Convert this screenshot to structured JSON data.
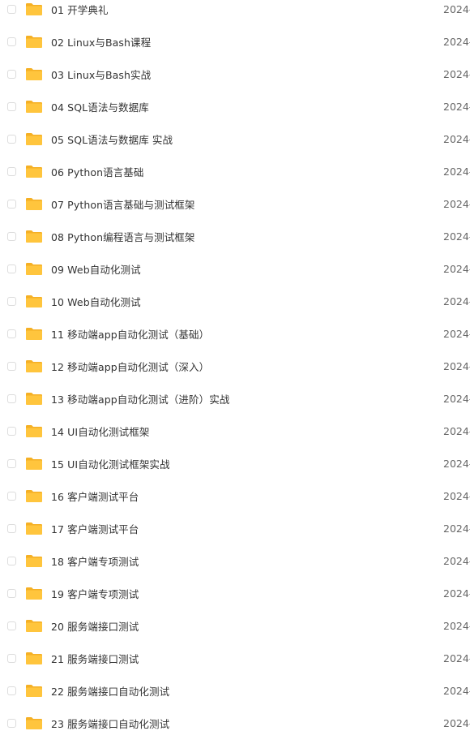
{
  "files": [
    {
      "name": "01 开学典礼",
      "date": "2024-"
    },
    {
      "name": "02 Linux与Bash课程",
      "date": "2024-"
    },
    {
      "name": "03 Linux与Bash实战",
      "date": "2024-"
    },
    {
      "name": "04 SQL语法与数据库",
      "date": "2024-"
    },
    {
      "name": "05 SQL语法与数据库 实战",
      "date": "2024-"
    },
    {
      "name": "06 Python语言基础",
      "date": "2024-"
    },
    {
      "name": "07 Python语言基础与测试框架",
      "date": "2024-"
    },
    {
      "name": "08 Python编程语言与测试框架",
      "date": "2024-"
    },
    {
      "name": "09 Web自动化测试",
      "date": "2024-"
    },
    {
      "name": "10 Web自动化测试",
      "date": "2024-"
    },
    {
      "name": "11 移动端app自动化测试（基础）",
      "date": "2024-"
    },
    {
      "name": "12 移动端app自动化测试（深入）",
      "date": "2024-"
    },
    {
      "name": "13 移动端app自动化测试（进阶）实战",
      "date": "2024-"
    },
    {
      "name": "14 UI自动化测试框架",
      "date": "2024-"
    },
    {
      "name": "15 UI自动化测试框架实战",
      "date": "2024-"
    },
    {
      "name": "16 客户端测试平台",
      "date": "2024-"
    },
    {
      "name": "17 客户端测试平台",
      "date": "2024-"
    },
    {
      "name": "18 客户端专项测试",
      "date": "2024-"
    },
    {
      "name": "19 客户端专项测试",
      "date": "2024-"
    },
    {
      "name": "20 服务端接口测试",
      "date": "2024-"
    },
    {
      "name": "21 服务端接口测试",
      "date": "2024-"
    },
    {
      "name": "22 服务端接口自动化测试",
      "date": "2024-"
    },
    {
      "name": "23 服务端接口自动化测试",
      "date": "2024-"
    }
  ],
  "icons": {
    "folder": "folder-icon",
    "checkbox": "checkbox"
  },
  "colors": {
    "folder": "#FFC53D",
    "folder_tab": "#F5B025",
    "text": "#333333",
    "date": "#666666",
    "checkbox_border": "#dcdcdc"
  }
}
